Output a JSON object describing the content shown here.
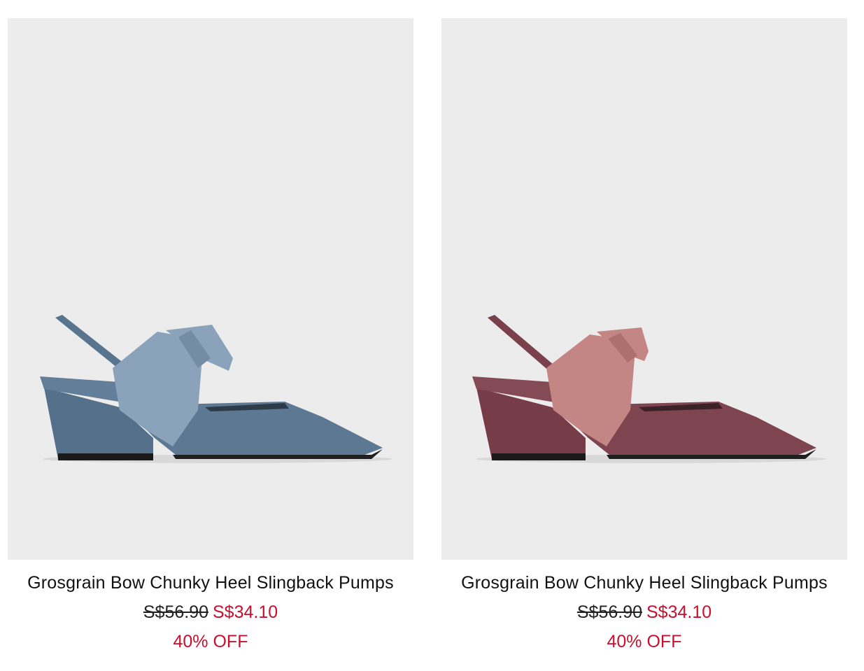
{
  "products": [
    {
      "name": "Grosgrain Bow Chunky Heel Slingback Pumps",
      "price_original": "S$56.90",
      "price_sale": "S$34.10",
      "discount": "40% OFF",
      "color_body": "#5d7893",
      "color_bow": "#8aa3bb",
      "icon": "slingback-pump-blue-image"
    },
    {
      "name": "Grosgrain Bow Chunky Heel Slingback Pumps",
      "price_original": "S$56.90",
      "price_sale": "S$34.10",
      "discount": "40% OFF",
      "color_body": "#7e4450",
      "color_bow": "#c48585",
      "icon": "slingback-pump-burgundy-image"
    }
  ],
  "colors": {
    "image_background": "#ececec",
    "sale_red": "#c8102e",
    "text": "#111111"
  }
}
